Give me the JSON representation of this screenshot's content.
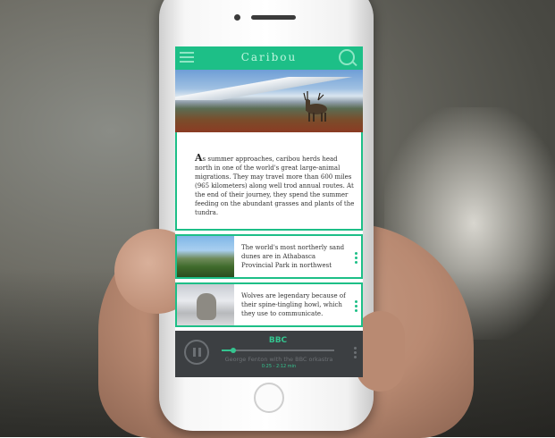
{
  "header": {
    "title": "Caribou",
    "menu_icon": "hamburger-menu-icon",
    "search_icon": "search-icon",
    "accent": "#1dbf87"
  },
  "article": {
    "dropcap": "A",
    "text": "s summer approaches, caribou herds head north in one of the world's great large-animal migrations. They may travel more than 600 miles (965 kilometers) along well trod annual routes. At the end of their journey, they spend the summer feeding on the abundant grasses and plants of the tundra."
  },
  "cards": [
    {
      "text": "The world's most northerly sand dunes are in Athabasca Provincial Park in northwest"
    },
    {
      "text": "Wolves are legendary because of their spine-tingling howl, which they use to communicate."
    }
  ],
  "player": {
    "station": "BBC",
    "track": "George Fenton with the BBC orkastra",
    "time": "0:25 - 2:12 min",
    "progress": 0.1,
    "accent": "#34c48f"
  }
}
